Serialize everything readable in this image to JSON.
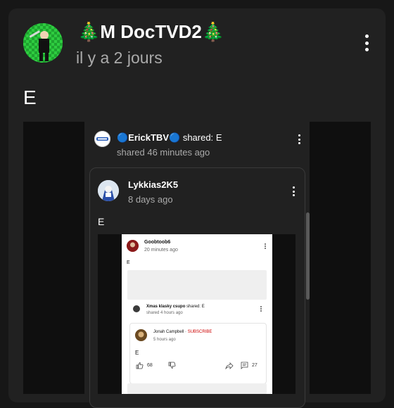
{
  "post": {
    "author": "🎄M DocTVD2🎄",
    "time": "il y a 2 jours",
    "body": "E"
  },
  "shared_post": {
    "sharer": "🔵ErickTBV🔵",
    "shared_word": "shared:",
    "shared_text": "E",
    "time": "shared 46 minutes ago",
    "original": {
      "author": "Lykkias2K5",
      "time": "8 days ago",
      "body": "E"
    }
  },
  "screenshot": {
    "author": "Goobtoob6",
    "time": "20 minutes ago",
    "body": "E",
    "share": {
      "sharer": "Xmas klasky csupo",
      "shared_word": "shared:",
      "shared_text": "E",
      "time": "shared 4 hours ago"
    },
    "nested": {
      "author": "Jonah Campbell",
      "separator": "·",
      "subscribe": "SUBSCRIBE",
      "time": "5 hours ago",
      "body": "E",
      "likes": "68",
      "comments": "27"
    }
  },
  "colors": {
    "background": "#171717",
    "card": "#212121",
    "secondary_text": "#aaaaaa",
    "subscribe_red": "#cc0000",
    "avatar_green": "#2ecc40"
  }
}
